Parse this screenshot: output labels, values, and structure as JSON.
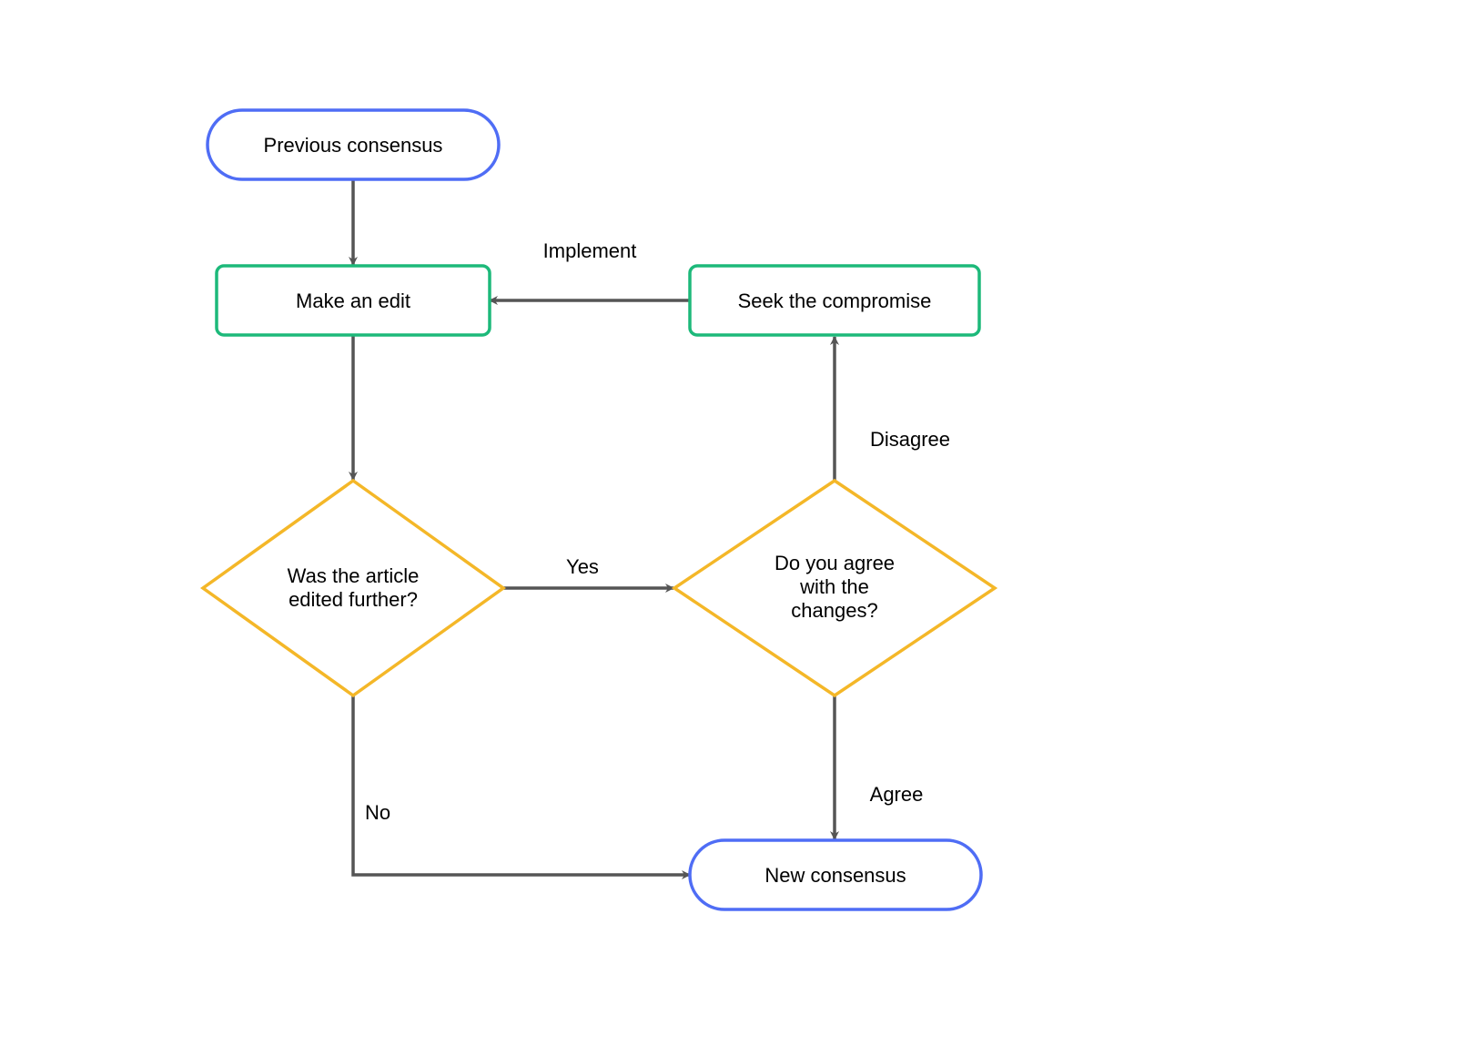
{
  "diagram": {
    "type": "flowchart",
    "nodes": {
      "prev_consensus": {
        "label": "Previous consensus",
        "shape": "terminator",
        "border": "#4f6df5"
      },
      "make_edit": {
        "label": "Make an edit",
        "shape": "process",
        "border": "#1db97a"
      },
      "seek_compromise": {
        "label": "Seek the compromise",
        "shape": "process",
        "border": "#1db97a"
      },
      "was_edited": {
        "label": "Was the article\nedited further?",
        "shape": "decision",
        "border": "#f4b728"
      },
      "agree_changes": {
        "label": "Do you agree\nwith the\nchanges?",
        "shape": "decision",
        "border": "#f4b728"
      },
      "new_consensus": {
        "label": "New consensus",
        "shape": "terminator",
        "border": "#4f6df5"
      }
    },
    "edges": {
      "e1": {
        "from": "prev_consensus",
        "to": "make_edit",
        "label": ""
      },
      "e2": {
        "from": "make_edit",
        "to": "was_edited",
        "label": ""
      },
      "e3": {
        "from": "was_edited",
        "to": "agree_changes",
        "label": "Yes"
      },
      "e4": {
        "from": "was_edited",
        "to": "new_consensus",
        "label": "No"
      },
      "e5": {
        "from": "agree_changes",
        "to": "new_consensus",
        "label": "Agree"
      },
      "e6": {
        "from": "agree_changes",
        "to": "seek_compromise",
        "label": "Disagree"
      },
      "e7": {
        "from": "seek_compromise",
        "to": "make_edit",
        "label": "Implement"
      }
    },
    "colors": {
      "arrow": "#555555"
    }
  }
}
